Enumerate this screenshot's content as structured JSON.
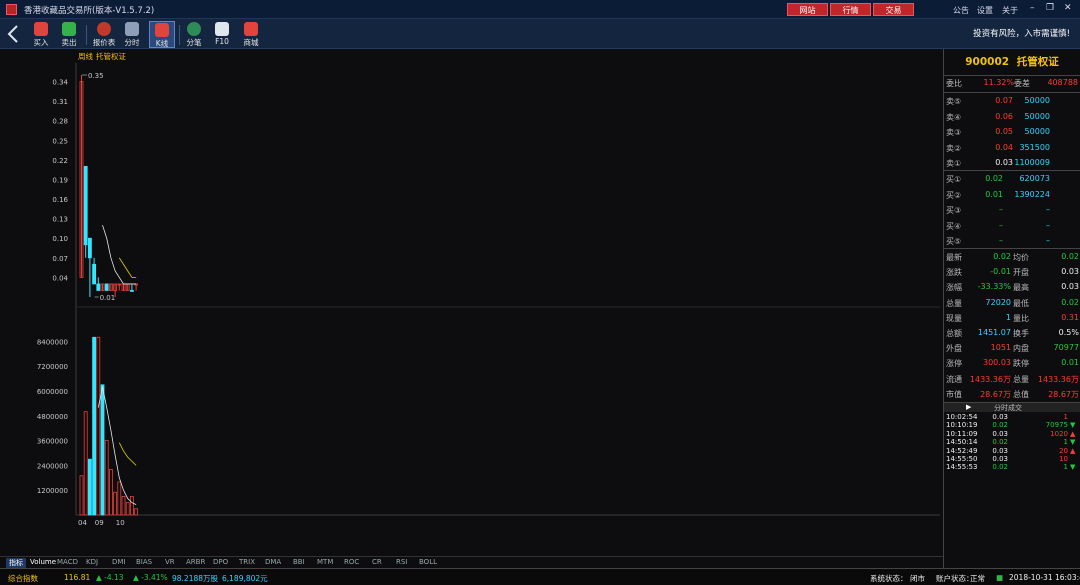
{
  "window": {
    "title": "香港收藏品交易所(版本-V1.5.7.2)",
    "top_buttons": [
      "网站",
      "行情",
      "交易"
    ],
    "top_links": [
      "公告",
      "设置",
      "关于"
    ]
  },
  "toolbar": {
    "items": [
      {
        "label": "买入",
        "icon": "buy-icon",
        "color": "#e0443c"
      },
      {
        "label": "卖出",
        "icon": "sell-icon",
        "color": "#35b24a"
      },
      {
        "label": "报价表",
        "icon": "quote-table-icon",
        "color": "#c0392b"
      },
      {
        "label": "分时",
        "icon": "timeshare-icon",
        "color": "#8e9fb8"
      },
      {
        "label": "K线",
        "icon": "kline-icon",
        "color": "#e0443c"
      },
      {
        "label": "分笔",
        "icon": "tick-icon",
        "color": "#2e8b57"
      },
      {
        "label": "F10",
        "icon": "f10-icon",
        "color": "#dfe6ee"
      },
      {
        "label": "商城",
        "icon": "mall-icon",
        "color": "#e0443c"
      }
    ],
    "risk_notice": "投资有风险，入市需谨慎!"
  },
  "chart": {
    "period_label": "周线",
    "name_label": "托管权证",
    "high_marker": "0.35",
    "low_marker": "0.01",
    "price_ticks": [
      "0.34",
      "0.31",
      "0.28",
      "0.25",
      "0.22",
      "0.19",
      "0.16",
      "0.13",
      "0.10",
      "0.07",
      "0.04"
    ],
    "volume_ticks": [
      "8400000",
      "7200000",
      "6000000",
      "4800000",
      "3600000",
      "2400000",
      "1200000"
    ],
    "date_ticks": [
      "04",
      "09",
      "10"
    ]
  },
  "chart_data": {
    "type": "candlestick",
    "candles": [
      {
        "o": 0.04,
        "h": 0.35,
        "l": 0.04,
        "c": 0.34,
        "up": true
      },
      {
        "o": 0.21,
        "h": 0.21,
        "l": 0.07,
        "c": 0.09,
        "up": false
      },
      {
        "o": 0.1,
        "h": 0.1,
        "l": 0.01,
        "c": 0.07,
        "up": false
      },
      {
        "o": 0.06,
        "h": 0.07,
        "l": 0.03,
        "c": 0.03,
        "up": false
      },
      {
        "o": 0.03,
        "h": 0.04,
        "l": 0.02,
        "c": 0.02,
        "up": false
      },
      {
        "o": 0.02,
        "h": 0.03,
        "l": 0.02,
        "c": 0.03,
        "up": true
      },
      {
        "o": 0.03,
        "h": 0.03,
        "l": 0.02,
        "c": 0.02,
        "up": false
      },
      {
        "o": 0.02,
        "h": 0.03,
        "l": 0.02,
        "c": 0.03,
        "up": true
      },
      {
        "o": 0.02,
        "h": 0.03,
        "l": 0.01,
        "c": 0.03,
        "up": true
      },
      {
        "o": 0.03,
        "h": 0.03,
        "l": 0.02,
        "c": 0.03,
        "up": true
      },
      {
        "o": 0.02,
        "h": 0.03,
        "l": 0.02,
        "c": 0.03,
        "up": true
      },
      {
        "o": 0.02,
        "h": 0.03,
        "l": 0.02,
        "c": 0.03,
        "up": true
      },
      {
        "o": 0.02,
        "h": 0.03,
        "l": 0.02,
        "c": 0.02,
        "up": false
      },
      {
        "o": 0.03,
        "h": 0.03,
        "l": 0.02,
        "c": 0.03,
        "up": true
      }
    ],
    "ma_white": [
      null,
      null,
      null,
      null,
      null,
      0.12,
      0.1,
      0.07,
      0.05,
      0.04,
      0.03,
      0.03,
      0.03,
      0.03
    ],
    "ma_yellow": [
      null,
      null,
      null,
      null,
      null,
      null,
      null,
      null,
      null,
      0.07,
      0.06,
      0.05,
      0.04,
      0.04
    ],
    "volumes": [
      {
        "v": 1900000,
        "up": true
      },
      {
        "v": 5000000,
        "up": true
      },
      {
        "v": 2700000,
        "up": false
      },
      {
        "v": 8600000,
        "up": false
      },
      {
        "v": 8600000,
        "up": true
      },
      {
        "v": 6300000,
        "up": false
      },
      {
        "v": 3600000,
        "up": true
      },
      {
        "v": 2200000,
        "up": true
      },
      {
        "v": 1100000,
        "up": true
      },
      {
        "v": 1600000,
        "up": true
      },
      {
        "v": 900000,
        "up": true
      },
      {
        "v": 600000,
        "up": true
      },
      {
        "v": 900000,
        "up": true
      },
      {
        "v": 300000,
        "up": true
      }
    ],
    "vol_ma_white": [
      null,
      null,
      null,
      null,
      5200000,
      6200000,
      5200000,
      4100000,
      2900000,
      1800000,
      1200000,
      800000,
      600000,
      500000
    ],
    "vol_ma_yellow": [
      null,
      null,
      null,
      null,
      null,
      null,
      null,
      null,
      null,
      3500000,
      3100000,
      2800000,
      2600000,
      2400000
    ],
    "price_range": [
      0.01,
      0.35
    ],
    "volume_range": [
      0,
      9000000
    ]
  },
  "indicator_tabs": [
    "指标",
    "Volume",
    "MACD",
    "KDJ",
    "DMI",
    "BIAS",
    "VR",
    "ARBR",
    "DPO",
    "TRIX",
    "DMA",
    "BBI",
    "MTM",
    "ROC",
    "CR",
    "RSI",
    "BOLL"
  ],
  "quote": {
    "code": "900002",
    "name": "托管权证",
    "ratio_label": "委比",
    "ratio_value": "11.32%",
    "diff_label": "委差",
    "diff_value": "408788",
    "asks": [
      {
        "label": "卖⑤",
        "price": "0.07",
        "vol": "50000"
      },
      {
        "label": "卖④",
        "price": "0.06",
        "vol": "50000"
      },
      {
        "label": "卖③",
        "price": "0.05",
        "vol": "50000"
      },
      {
        "label": "卖②",
        "price": "0.04",
        "vol": "351500"
      },
      {
        "label": "卖①",
        "price": "0.03",
        "vol": "1100009"
      }
    ],
    "bids": [
      {
        "label": "买①",
        "price": "0.02",
        "vol": "620073"
      },
      {
        "label": "买②",
        "price": "0.01",
        "vol": "1390224"
      },
      {
        "label": "买③",
        "price": "–",
        "vol": "–"
      },
      {
        "label": "买④",
        "price": "–",
        "vol": "–"
      },
      {
        "label": "买⑤",
        "price": "–",
        "vol": "–"
      }
    ],
    "stats": [
      {
        "l1": "最新",
        "v1": "0.02",
        "c1": "green",
        "l2": "均价",
        "v2": "0.02",
        "c2": "green"
      },
      {
        "l1": "涨跌",
        "v1": "-0.01",
        "c1": "green",
        "l2": "开盘",
        "v2": "0.03",
        "c2": "white"
      },
      {
        "l1": "涨幅",
        "v1": "-33.33%",
        "c1": "green",
        "l2": "最高",
        "v2": "0.03",
        "c2": "white"
      },
      {
        "l1": "总量",
        "v1": "72020",
        "c1": "cyan",
        "l2": "最低",
        "v2": "0.02",
        "c2": "green"
      },
      {
        "l1": "现量",
        "v1": "1",
        "c1": "cyan",
        "l2": "量比",
        "v2": "0.31",
        "c2": "red"
      },
      {
        "l1": "总额",
        "v1": "1451.07",
        "c1": "cyan",
        "l2": "换手",
        "v2": "0.5%",
        "c2": "white"
      },
      {
        "l1": "外盘",
        "v1": "1051",
        "c1": "red",
        "l2": "内盘",
        "v2": "70977",
        "c2": "green"
      },
      {
        "l1": "涨停",
        "v1": "300.03",
        "c1": "red",
        "l2": "跌停",
        "v2": "0.01",
        "c2": "green"
      },
      {
        "l1": "流通",
        "v1": "1433.36万",
        "c1": "red",
        "l2": "总量",
        "v2": "1433.36万",
        "c2": "red"
      },
      {
        "l1": "市值",
        "v1": "28.67万",
        "c1": "red",
        "l2": "总值",
        "v2": "28.67万",
        "c2": "red"
      }
    ],
    "trades_title": "分时成交",
    "trades": [
      {
        "time": "10:02:54",
        "price": "0.03",
        "pc": "white",
        "vol": "1",
        "vc": "red",
        "arrow": ""
      },
      {
        "time": "10:10:19",
        "price": "0.02",
        "pc": "green",
        "vol": "70975",
        "vc": "green",
        "arrow": "▼"
      },
      {
        "time": "10:11:09",
        "price": "0.03",
        "pc": "white",
        "vol": "1020",
        "vc": "red",
        "arrow": "▲"
      },
      {
        "time": "14:50:14",
        "price": "0.02",
        "pc": "green",
        "vol": "1",
        "vc": "green",
        "arrow": "▼"
      },
      {
        "time": "14:52:49",
        "price": "0.03",
        "pc": "white",
        "vol": "20",
        "vc": "red",
        "arrow": "▲"
      },
      {
        "time": "14:55:50",
        "price": "0.03",
        "pc": "white",
        "vol": "10",
        "vc": "red",
        "arrow": ""
      },
      {
        "time": "14:55:53",
        "price": "0.02",
        "pc": "green",
        "vol": "1",
        "vc": "green",
        "arrow": "▼"
      }
    ]
  },
  "status": {
    "index_label": "综合指数",
    "index_value": "116.81",
    "index_change": "▲ -4.13",
    "index_pct": "▲ -3.41%",
    "index_volume": "98.2188万股",
    "index_amount": "6,189,802元",
    "system_label": "系统状态：",
    "system_value": "闭市",
    "account_label": "账户状态：",
    "account_value": "正常",
    "datetime": "2018-10-31 16:03:40"
  }
}
